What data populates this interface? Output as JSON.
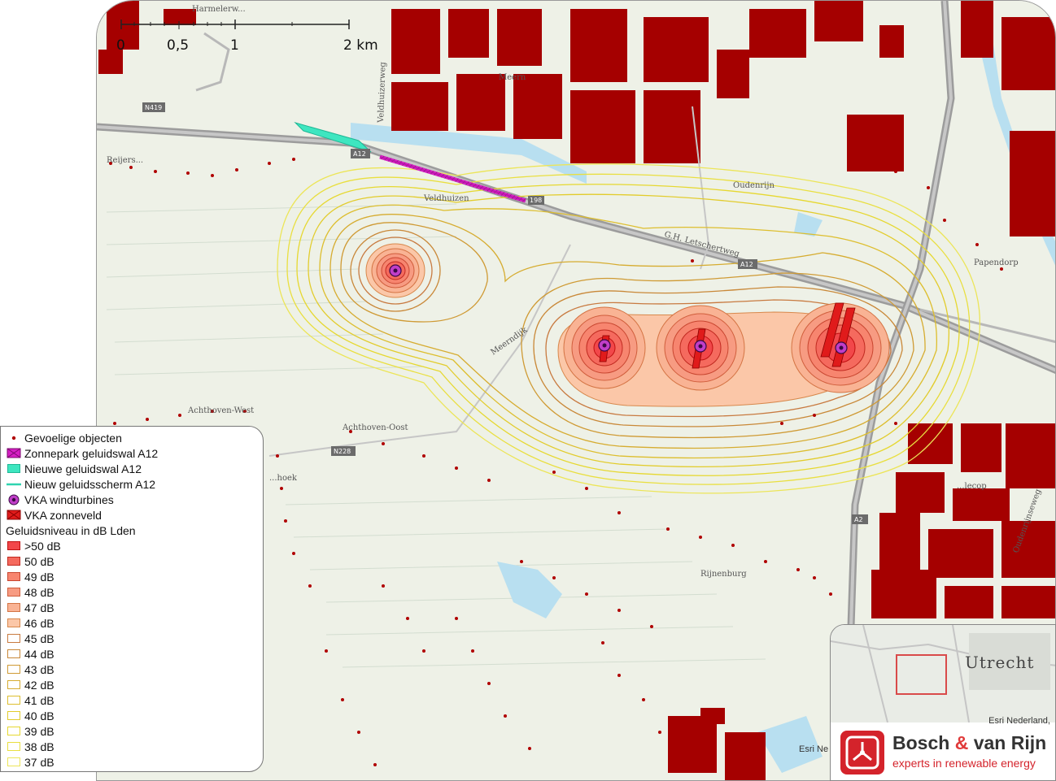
{
  "scale_bar": {
    "labels": [
      "0",
      "0,5",
      "1",
      "2 km"
    ]
  },
  "map_labels": [
    "Harmelerw...",
    "Reijers...",
    "Veldhuizen",
    "Meern",
    "Oudenrijn",
    "G.H. Letschertweg",
    "Papendorp",
    "Meerndijk",
    "Achthoven-West",
    "Achthoven-Oost",
    "...hoek",
    "Rijnenburg",
    "...lecop",
    "Oudenrijnseweg",
    "Veldhuizerweg"
  ],
  "road_badges": [
    "N419",
    "A12",
    "A12",
    "N228",
    "A2",
    "198"
  ],
  "legend": {
    "items": [
      {
        "label": "Gevoelige objecten",
        "symbol": "dot",
        "color": "#b00000"
      },
      {
        "label": "Zonnepark geluidswal A12",
        "symbol": "hatch",
        "color": "#d61fc4"
      },
      {
        "label": "Nieuwe geluidswal A12",
        "symbol": "fill",
        "color": "#3ee6c0"
      },
      {
        "label": "Nieuw geluidsscherm A12",
        "symbol": "line",
        "color": "#2fd4b0"
      },
      {
        "label": "VKA windturbines",
        "symbol": "turbine",
        "color": "#8a1a9a"
      },
      {
        "label": "VKA zonneveld",
        "symbol": "hatch-red",
        "color": "#e01b1b"
      }
    ],
    "noise_title": "Geluidsniveau in dB Lden",
    "noise_classes": [
      {
        "label": ">50 dB",
        "fill": "#f2474a",
        "stroke": "#c01010"
      },
      {
        "label": "50 dB",
        "fill": "#f56a5e",
        "stroke": "#c02a20"
      },
      {
        "label": "49 dB",
        "fill": "#f7856f",
        "stroke": "#c84630"
      },
      {
        "label": "48 dB",
        "fill": "#f79b82",
        "stroke": "#d05e3c"
      },
      {
        "label": "47 dB",
        "fill": "#f9b394",
        "stroke": "#d47444"
      },
      {
        "label": "46 dB",
        "fill": "#fbc7a8",
        "stroke": "#d8884c"
      },
      {
        "label": "45 dB",
        "fill": "#ffffff",
        "stroke": "#c87a40"
      },
      {
        "label": "44 dB",
        "fill": "#ffffff",
        "stroke": "#c98838"
      },
      {
        "label": "43 dB",
        "fill": "#ffffff",
        "stroke": "#cf9a34"
      },
      {
        "label": "42 dB",
        "fill": "#ffffff",
        "stroke": "#d6ac30"
      },
      {
        "label": "41 dB",
        "fill": "#ffffff",
        "stroke": "#ddbe2e"
      },
      {
        "label": "40 dB",
        "fill": "#ffffff",
        "stroke": "#e2cc2c"
      },
      {
        "label": "39 dB",
        "fill": "#ffffff",
        "stroke": "#e6d830"
      },
      {
        "label": "38 dB",
        "fill": "#ffffff",
        "stroke": "#e9df40"
      },
      {
        "label": "37 dB",
        "fill": "#ffffff",
        "stroke": "#ece558"
      }
    ]
  },
  "inset": {
    "city": "Utrecht",
    "attribution": "Esri Nederland,"
  },
  "map_attribution": "Esri Ne",
  "brand": {
    "name_part1": "Bosch ",
    "name_amp": "&",
    "name_part2": " van Rijn",
    "tagline": "experts in renewable energy"
  },
  "turbines": [
    {
      "name": "turbine-1"
    },
    {
      "name": "turbine-2"
    },
    {
      "name": "turbine-3"
    },
    {
      "name": "turbine-4"
    }
  ],
  "colors": {
    "building": "#a50000",
    "road": "#a6a6a6",
    "water": "#a8d8ea",
    "accent": "#d4232b"
  }
}
